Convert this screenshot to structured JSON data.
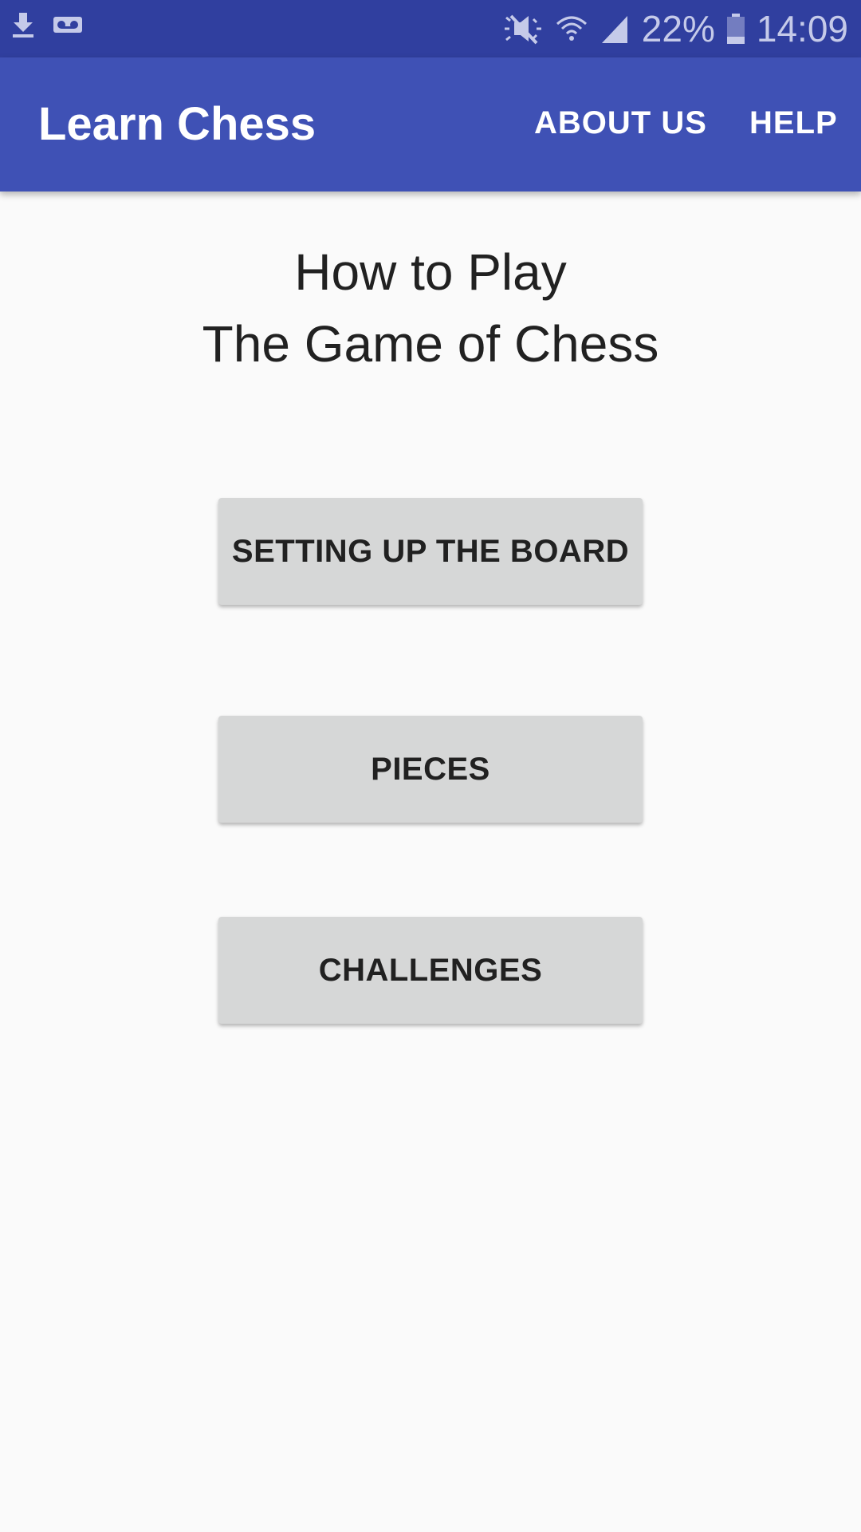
{
  "status_bar": {
    "battery_percent": "22%",
    "time": "14:09",
    "icons": [
      "download-icon",
      "voicemail-icon",
      "mute-icon",
      "wifi-icon",
      "signal-icon",
      "battery-icon"
    ]
  },
  "app_bar": {
    "title": "Learn Chess",
    "actions": [
      {
        "label": "ABOUT US"
      },
      {
        "label": "HELP"
      }
    ],
    "color": "#3f51b5"
  },
  "main": {
    "heading_line1": "How to Play",
    "heading_line2": "The Game of Chess",
    "buttons": [
      {
        "label": "SETTING UP THE BOARD"
      },
      {
        "label": "PIECES"
      },
      {
        "label": "CHALLENGES"
      }
    ]
  }
}
